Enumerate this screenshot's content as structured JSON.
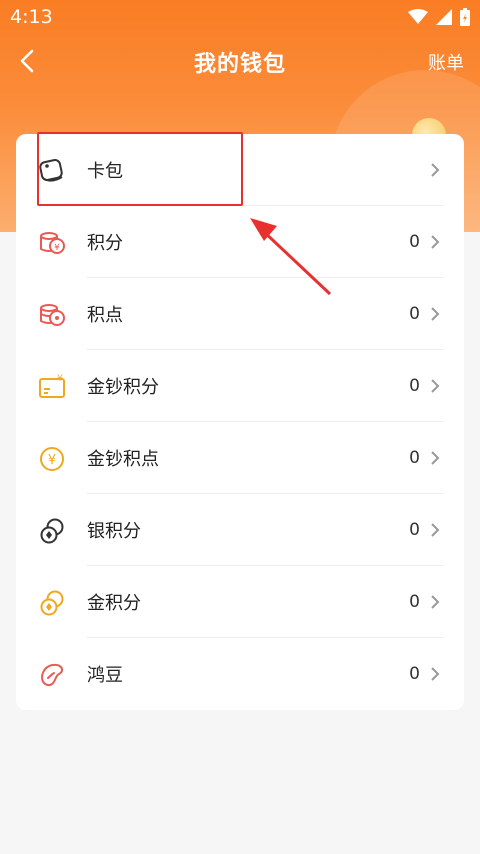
{
  "status_bar": {
    "time": "4:13"
  },
  "header": {
    "title": "我的钱包",
    "bill_label": "账单"
  },
  "items": [
    {
      "label": "卡包",
      "value": ""
    },
    {
      "label": "积分",
      "value": "0"
    },
    {
      "label": "积点",
      "value": "0"
    },
    {
      "label": "金钞积分",
      "value": "0"
    },
    {
      "label": "金钞积点",
      "value": "0"
    },
    {
      "label": "银积分",
      "value": "0"
    },
    {
      "label": "金积分",
      "value": "0"
    },
    {
      "label": "鸿豆",
      "value": "0"
    }
  ],
  "colors": {
    "accent": "#fa7d24",
    "annotation": "#e8312f"
  },
  "icons": [
    "card-icon",
    "points-coin-icon",
    "points-stack-icon",
    "gold-note-icon",
    "yen-coin-icon",
    "silver-coins-icon",
    "gold-coins-icon",
    "bean-icon"
  ]
}
